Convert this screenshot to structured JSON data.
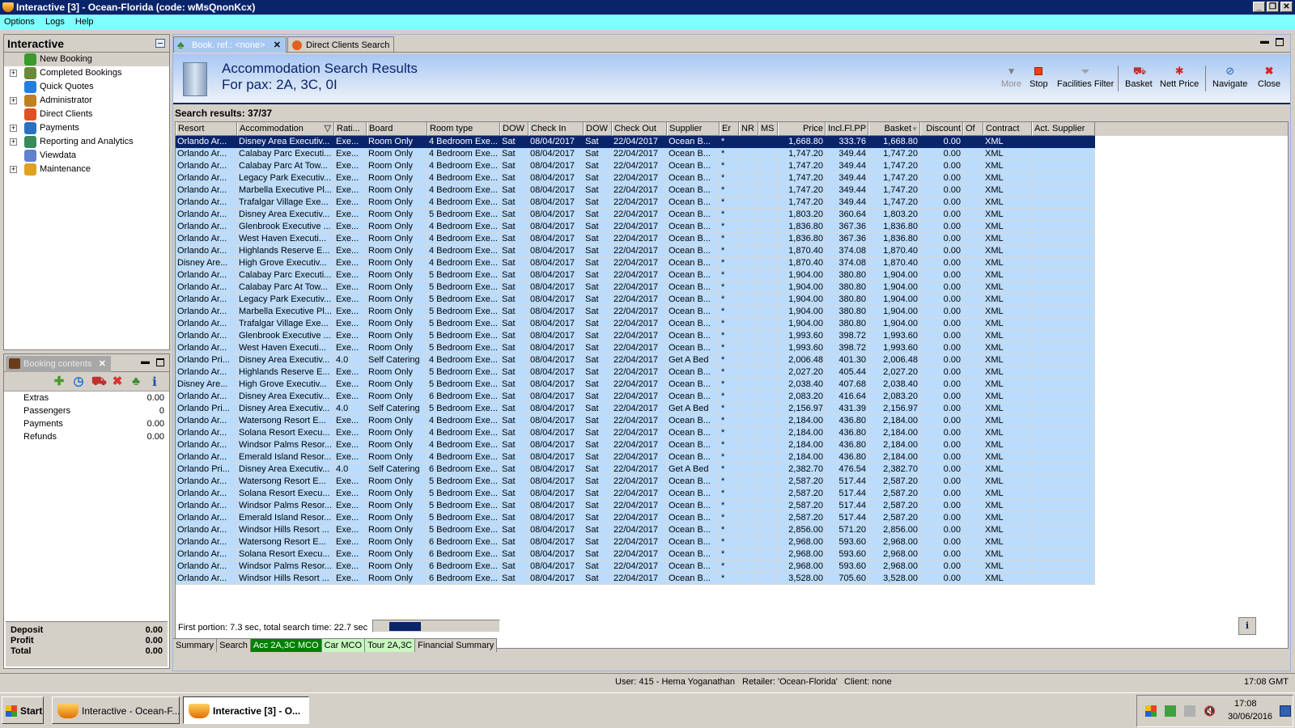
{
  "window": {
    "title": "Interactive [3] - Ocean-Florida (code: wMsQnonKcx)"
  },
  "menu": [
    "Options",
    "Logs",
    "Help"
  ],
  "sidebar": {
    "title": "Interactive",
    "items": [
      {
        "label": "New Booking",
        "expandable": false,
        "icon": "palm-tree-icon"
      },
      {
        "label": "Completed Bookings",
        "expandable": true,
        "icon": "palm-money-icon"
      },
      {
        "label": "Quick Quotes",
        "expandable": false,
        "icon": "clock-icon"
      },
      {
        "label": "Administrator",
        "expandable": true,
        "icon": "runner-icon"
      },
      {
        "label": "Direct Clients",
        "expandable": false,
        "icon": "person-icon"
      },
      {
        "label": "Payments",
        "expandable": true,
        "icon": "payment-card-icon"
      },
      {
        "label": "Reporting and Analytics",
        "expandable": true,
        "icon": "report-icon"
      },
      {
        "label": "Viewdata",
        "expandable": false,
        "icon": "globe-icon"
      },
      {
        "label": "Maintenance",
        "expandable": true,
        "icon": "maintenance-icon"
      }
    ]
  },
  "booking_contents": {
    "tab_label": "Booking contents",
    "rows": [
      {
        "label": "Extras",
        "value": "0.00"
      },
      {
        "label": "Passengers",
        "value": "0"
      },
      {
        "label": "Payments",
        "value": "0.00"
      },
      {
        "label": "Refunds",
        "value": "0.00"
      }
    ],
    "summary": [
      {
        "label": "Deposit",
        "value": "0.00"
      },
      {
        "label": "Profit",
        "value": "0.00"
      },
      {
        "label": "Total",
        "value": "0.00"
      }
    ]
  },
  "tabs": [
    {
      "label": "Book. ref.: <none>",
      "active": true
    },
    {
      "label": "Direct Clients Search",
      "active": false
    }
  ],
  "header": {
    "title": "Accommodation Search Results",
    "subtitle": "For pax: 2A, 3C, 0I"
  },
  "toolbar": [
    {
      "label": "More",
      "icon": "triangle-down-icon",
      "enabled": false
    },
    {
      "label": "Stop",
      "icon": "stop-icon",
      "enabled": true
    },
    {
      "label": "Facilities Filter",
      "icon": "funnel-icon",
      "enabled": true
    },
    {
      "label": "Basket",
      "icon": "cart-icon",
      "enabled": true
    },
    {
      "label": "Nett Price",
      "icon": "nett-price-icon",
      "enabled": true
    },
    {
      "label": "Navigate",
      "icon": "compass-icon",
      "enabled": true
    },
    {
      "label": "Close",
      "icon": "close-icon",
      "enabled": true
    }
  ],
  "results": {
    "label": "Search results: 37/37",
    "columns": [
      "Resort",
      "Accommodation",
      "Rati...",
      "Board",
      "Room type",
      "DOW",
      "Check In",
      "DOW",
      "Check Out",
      "Supplier",
      "Er",
      "NR",
      "MS",
      "Price",
      "Incl.Fl.PP",
      "Basket",
      "Discount",
      "Of",
      "Contract",
      "Act. Supplier"
    ],
    "selected_row": 0,
    "rows": [
      [
        "Orlando Ar...",
        "Disney Area Executiv...",
        "Exe...",
        "Room Only",
        "4 Bedroom Exe...",
        "Sat",
        "08/04/2017",
        "Sat",
        "22/04/2017",
        "Ocean B...",
        "*",
        "",
        "",
        "1,668.80",
        "333.76",
        "1,668.80",
        "0.00",
        "",
        "XML",
        ""
      ],
      [
        "Orlando Ar...",
        "Calabay Parc Executi...",
        "Exe...",
        "Room Only",
        "4 Bedroom Exe...",
        "Sat",
        "08/04/2017",
        "Sat",
        "22/04/2017",
        "Ocean B...",
        "*",
        "",
        "",
        "1,747.20",
        "349.44",
        "1,747.20",
        "0.00",
        "",
        "XML",
        ""
      ],
      [
        "Orlando Ar...",
        "Calabay Parc At Tow...",
        "Exe...",
        "Room Only",
        "4 Bedroom Exe...",
        "Sat",
        "08/04/2017",
        "Sat",
        "22/04/2017",
        "Ocean B...",
        "*",
        "",
        "",
        "1,747.20",
        "349.44",
        "1,747.20",
        "0.00",
        "",
        "XML",
        ""
      ],
      [
        "Orlando Ar...",
        "Legacy Park Executiv...",
        "Exe...",
        "Room Only",
        "4 Bedroom Exe...",
        "Sat",
        "08/04/2017",
        "Sat",
        "22/04/2017",
        "Ocean B...",
        "*",
        "",
        "",
        "1,747.20",
        "349.44",
        "1,747.20",
        "0.00",
        "",
        "XML",
        ""
      ],
      [
        "Orlando Ar...",
        "Marbella Executive Pl...",
        "Exe...",
        "Room Only",
        "4 Bedroom Exe...",
        "Sat",
        "08/04/2017",
        "Sat",
        "22/04/2017",
        "Ocean B...",
        "*",
        "",
        "",
        "1,747.20",
        "349.44",
        "1,747.20",
        "0.00",
        "",
        "XML",
        ""
      ],
      [
        "Orlando Ar...",
        "Trafalgar Village Exe...",
        "Exe...",
        "Room Only",
        "4 Bedroom Exe...",
        "Sat",
        "08/04/2017",
        "Sat",
        "22/04/2017",
        "Ocean B...",
        "*",
        "",
        "",
        "1,747.20",
        "349.44",
        "1,747.20",
        "0.00",
        "",
        "XML",
        ""
      ],
      [
        "Orlando Ar...",
        "Disney Area Executiv...",
        "Exe...",
        "Room Only",
        "5 Bedroom Exe...",
        "Sat",
        "08/04/2017",
        "Sat",
        "22/04/2017",
        "Ocean B...",
        "*",
        "",
        "",
        "1,803.20",
        "360.64",
        "1,803.20",
        "0.00",
        "",
        "XML",
        ""
      ],
      [
        "Orlando Ar...",
        "Glenbrook Executive ...",
        "Exe...",
        "Room Only",
        "4 Bedroom Exe...",
        "Sat",
        "08/04/2017",
        "Sat",
        "22/04/2017",
        "Ocean B...",
        "*",
        "",
        "",
        "1,836.80",
        "367.36",
        "1,836.80",
        "0.00",
        "",
        "XML",
        ""
      ],
      [
        "Orlando Ar...",
        "West Haven Executi...",
        "Exe...",
        "Room Only",
        "4 Bedroom Exe...",
        "Sat",
        "08/04/2017",
        "Sat",
        "22/04/2017",
        "Ocean B...",
        "*",
        "",
        "",
        "1,836.80",
        "367.36",
        "1,836.80",
        "0.00",
        "",
        "XML",
        ""
      ],
      [
        "Orlando Ar...",
        "Highlands Reserve E...",
        "Exe...",
        "Room Only",
        "4 Bedroom Exe...",
        "Sat",
        "08/04/2017",
        "Sat",
        "22/04/2017",
        "Ocean B...",
        "*",
        "",
        "",
        "1,870.40",
        "374.08",
        "1,870.40",
        "0.00",
        "",
        "XML",
        ""
      ],
      [
        "Disney Are...",
        "High Grove Executiv...",
        "Exe...",
        "Room Only",
        "4 Bedroom Exe...",
        "Sat",
        "08/04/2017",
        "Sat",
        "22/04/2017",
        "Ocean B...",
        "*",
        "",
        "",
        "1,870.40",
        "374.08",
        "1,870.40",
        "0.00",
        "",
        "XML",
        ""
      ],
      [
        "Orlando Ar...",
        "Calabay Parc Executi...",
        "Exe...",
        "Room Only",
        "5 Bedroom Exe...",
        "Sat",
        "08/04/2017",
        "Sat",
        "22/04/2017",
        "Ocean B...",
        "*",
        "",
        "",
        "1,904.00",
        "380.80",
        "1,904.00",
        "0.00",
        "",
        "XML",
        ""
      ],
      [
        "Orlando Ar...",
        "Calabay Parc At Tow...",
        "Exe...",
        "Room Only",
        "5 Bedroom Exe...",
        "Sat",
        "08/04/2017",
        "Sat",
        "22/04/2017",
        "Ocean B...",
        "*",
        "",
        "",
        "1,904.00",
        "380.80",
        "1,904.00",
        "0.00",
        "",
        "XML",
        ""
      ],
      [
        "Orlando Ar...",
        "Legacy Park Executiv...",
        "Exe...",
        "Room Only",
        "5 Bedroom Exe...",
        "Sat",
        "08/04/2017",
        "Sat",
        "22/04/2017",
        "Ocean B...",
        "*",
        "",
        "",
        "1,904.00",
        "380.80",
        "1,904.00",
        "0.00",
        "",
        "XML",
        ""
      ],
      [
        "Orlando Ar...",
        "Marbella Executive Pl...",
        "Exe...",
        "Room Only",
        "5 Bedroom Exe...",
        "Sat",
        "08/04/2017",
        "Sat",
        "22/04/2017",
        "Ocean B...",
        "*",
        "",
        "",
        "1,904.00",
        "380.80",
        "1,904.00",
        "0.00",
        "",
        "XML",
        ""
      ],
      [
        "Orlando Ar...",
        "Trafalgar Village Exe...",
        "Exe...",
        "Room Only",
        "5 Bedroom Exe...",
        "Sat",
        "08/04/2017",
        "Sat",
        "22/04/2017",
        "Ocean B...",
        "*",
        "",
        "",
        "1,904.00",
        "380.80",
        "1,904.00",
        "0.00",
        "",
        "XML",
        ""
      ],
      [
        "Orlando Ar...",
        "Glenbrook Executive ...",
        "Exe...",
        "Room Only",
        "5 Bedroom Exe...",
        "Sat",
        "08/04/2017",
        "Sat",
        "22/04/2017",
        "Ocean B...",
        "*",
        "",
        "",
        "1,993.60",
        "398.72",
        "1,993.60",
        "0.00",
        "",
        "XML",
        ""
      ],
      [
        "Orlando Ar...",
        "West Haven Executi...",
        "Exe...",
        "Room Only",
        "5 Bedroom Exe...",
        "Sat",
        "08/04/2017",
        "Sat",
        "22/04/2017",
        "Ocean B...",
        "*",
        "",
        "",
        "1,993.60",
        "398.72",
        "1,993.60",
        "0.00",
        "",
        "XML",
        ""
      ],
      [
        "Orlando Pri...",
        "Disney Area Executiv...",
        "4.0",
        "Self Catering",
        "4 Bedroom Exe...",
        "Sat",
        "08/04/2017",
        "Sat",
        "22/04/2017",
        "Get A Bed",
        "*",
        "",
        "",
        "2,006.48",
        "401.30",
        "2,006.48",
        "0.00",
        "",
        "XML",
        ""
      ],
      [
        "Orlando Ar...",
        "Highlands Reserve E...",
        "Exe...",
        "Room Only",
        "5 Bedroom Exe...",
        "Sat",
        "08/04/2017",
        "Sat",
        "22/04/2017",
        "Ocean B...",
        "*",
        "",
        "",
        "2,027.20",
        "405.44",
        "2,027.20",
        "0.00",
        "",
        "XML",
        ""
      ],
      [
        "Disney Are...",
        "High Grove Executiv...",
        "Exe...",
        "Room Only",
        "5 Bedroom Exe...",
        "Sat",
        "08/04/2017",
        "Sat",
        "22/04/2017",
        "Ocean B...",
        "*",
        "",
        "",
        "2,038.40",
        "407.68",
        "2,038.40",
        "0.00",
        "",
        "XML",
        ""
      ],
      [
        "Orlando Ar...",
        "Disney Area Executiv...",
        "Exe...",
        "Room Only",
        "6 Bedroom Exe...",
        "Sat",
        "08/04/2017",
        "Sat",
        "22/04/2017",
        "Ocean B...",
        "*",
        "",
        "",
        "2,083.20",
        "416.64",
        "2,083.20",
        "0.00",
        "",
        "XML",
        ""
      ],
      [
        "Orlando Pri...",
        "Disney Area Executiv...",
        "4.0",
        "Self Catering",
        "5 Bedroom Exe...",
        "Sat",
        "08/04/2017",
        "Sat",
        "22/04/2017",
        "Get A Bed",
        "*",
        "",
        "",
        "2,156.97",
        "431.39",
        "2,156.97",
        "0.00",
        "",
        "XML",
        ""
      ],
      [
        "Orlando Ar...",
        "Watersong Resort E...",
        "Exe...",
        "Room Only",
        "4 Bedroom Exe...",
        "Sat",
        "08/04/2017",
        "Sat",
        "22/04/2017",
        "Ocean B...",
        "*",
        "",
        "",
        "2,184.00",
        "436.80",
        "2,184.00",
        "0.00",
        "",
        "XML",
        ""
      ],
      [
        "Orlando Ar...",
        "Solana Resort Execu...",
        "Exe...",
        "Room Only",
        "4 Bedroom Exe...",
        "Sat",
        "08/04/2017",
        "Sat",
        "22/04/2017",
        "Ocean B...",
        "*",
        "",
        "",
        "2,184.00",
        "436.80",
        "2,184.00",
        "0.00",
        "",
        "XML",
        ""
      ],
      [
        "Orlando Ar...",
        "Windsor Palms Resor...",
        "Exe...",
        "Room Only",
        "4 Bedroom Exe...",
        "Sat",
        "08/04/2017",
        "Sat",
        "22/04/2017",
        "Ocean B...",
        "*",
        "",
        "",
        "2,184.00",
        "436.80",
        "2,184.00",
        "0.00",
        "",
        "XML",
        ""
      ],
      [
        "Orlando Ar...",
        "Emerald Island Resor...",
        "Exe...",
        "Room Only",
        "4 Bedroom Exe...",
        "Sat",
        "08/04/2017",
        "Sat",
        "22/04/2017",
        "Ocean B...",
        "*",
        "",
        "",
        "2,184.00",
        "436.80",
        "2,184.00",
        "0.00",
        "",
        "XML",
        ""
      ],
      [
        "Orlando Pri...",
        "Disney Area Executiv...",
        "4.0",
        "Self Catering",
        "6 Bedroom Exe...",
        "Sat",
        "08/04/2017",
        "Sat",
        "22/04/2017",
        "Get A Bed",
        "*",
        "",
        "",
        "2,382.70",
        "476.54",
        "2,382.70",
        "0.00",
        "",
        "XML",
        ""
      ],
      [
        "Orlando Ar...",
        "Watersong Resort E...",
        "Exe...",
        "Room Only",
        "5 Bedroom Exe...",
        "Sat",
        "08/04/2017",
        "Sat",
        "22/04/2017",
        "Ocean B...",
        "*",
        "",
        "",
        "2,587.20",
        "517.44",
        "2,587.20",
        "0.00",
        "",
        "XML",
        ""
      ],
      [
        "Orlando Ar...",
        "Solana Resort Execu...",
        "Exe...",
        "Room Only",
        "5 Bedroom Exe...",
        "Sat",
        "08/04/2017",
        "Sat",
        "22/04/2017",
        "Ocean B...",
        "*",
        "",
        "",
        "2,587.20",
        "517.44",
        "2,587.20",
        "0.00",
        "",
        "XML",
        ""
      ],
      [
        "Orlando Ar...",
        "Windsor Palms Resor...",
        "Exe...",
        "Room Only",
        "5 Bedroom Exe...",
        "Sat",
        "08/04/2017",
        "Sat",
        "22/04/2017",
        "Ocean B...",
        "*",
        "",
        "",
        "2,587.20",
        "517.44",
        "2,587.20",
        "0.00",
        "",
        "XML",
        ""
      ],
      [
        "Orlando Ar...",
        "Emerald Island Resor...",
        "Exe...",
        "Room Only",
        "5 Bedroom Exe...",
        "Sat",
        "08/04/2017",
        "Sat",
        "22/04/2017",
        "Ocean B...",
        "*",
        "",
        "",
        "2,587.20",
        "517.44",
        "2,587.20",
        "0.00",
        "",
        "XML",
        ""
      ],
      [
        "Orlando Ar...",
        "Windsor Hills Resort ...",
        "Exe...",
        "Room Only",
        "5 Bedroom Exe...",
        "Sat",
        "08/04/2017",
        "Sat",
        "22/04/2017",
        "Ocean B...",
        "*",
        "",
        "",
        "2,856.00",
        "571.20",
        "2,856.00",
        "0.00",
        "",
        "XML",
        ""
      ],
      [
        "Orlando Ar...",
        "Watersong Resort E...",
        "Exe...",
        "Room Only",
        "6 Bedroom Exe...",
        "Sat",
        "08/04/2017",
        "Sat",
        "22/04/2017",
        "Ocean B...",
        "*",
        "",
        "",
        "2,968.00",
        "593.60",
        "2,968.00",
        "0.00",
        "",
        "XML",
        ""
      ],
      [
        "Orlando Ar...",
        "Solana Resort Execu...",
        "Exe...",
        "Room Only",
        "6 Bedroom Exe...",
        "Sat",
        "08/04/2017",
        "Sat",
        "22/04/2017",
        "Ocean B...",
        "*",
        "",
        "",
        "2,968.00",
        "593.60",
        "2,968.00",
        "0.00",
        "",
        "XML",
        ""
      ],
      [
        "Orlando Ar...",
        "Windsor Palms Resor...",
        "Exe...",
        "Room Only",
        "6 Bedroom Exe...",
        "Sat",
        "08/04/2017",
        "Sat",
        "22/04/2017",
        "Ocean B...",
        "*",
        "",
        "",
        "2,968.00",
        "593.60",
        "2,968.00",
        "0.00",
        "",
        "XML",
        ""
      ],
      [
        "Orlando Ar...",
        "Windsor Hills Resort ...",
        "Exe...",
        "Room Only",
        "6 Bedroom Exe...",
        "Sat",
        "08/04/2017",
        "Sat",
        "22/04/2017",
        "Ocean B...",
        "*",
        "",
        "",
        "3,528.00",
        "705.60",
        "3,528.00",
        "0.00",
        "",
        "XML",
        ""
      ]
    ]
  },
  "search_status": {
    "text": "First portion: 7.3 sec, total search time: 22.7 sec",
    "progress_percent": 25
  },
  "bottom_tabs": [
    {
      "label": "Summary",
      "color": "#d4d0c8",
      "text_color": "#000000"
    },
    {
      "label": "Search",
      "color": "#d4d0c8",
      "text_color": "#000000"
    },
    {
      "label": "Acc 2A,3C MCO",
      "color": "#008000",
      "text_color": "#ffffff"
    },
    {
      "label": "Car MCO",
      "color": "#c8f8c0",
      "text_color": "#000000"
    },
    {
      "label": "Tour 2A,3C",
      "color": "#c8f8c0",
      "text_color": "#000000"
    },
    {
      "label": "Financial Summary",
      "color": "#d4d0c8",
      "text_color": "#000000"
    }
  ],
  "statusbar": {
    "user": "User: 415 - Hema Yoganathan",
    "retailer": "Retailer: 'Ocean-Florida'",
    "client": "Client: none",
    "time": "17:08 GMT"
  },
  "taskbar": {
    "start": "Start",
    "buttons": [
      {
        "label": "Interactive - Ocean-F...",
        "active": false
      },
      {
        "label": "Interactive [3] - O...",
        "active": true
      }
    ],
    "clock_time": "17:08",
    "clock_date": "30/06/2016"
  },
  "colors": {
    "selection": "#0a246a",
    "row_bg": "#bbdcfc",
    "menubar": "#80ffff",
    "titlebar": "#0a246a"
  }
}
